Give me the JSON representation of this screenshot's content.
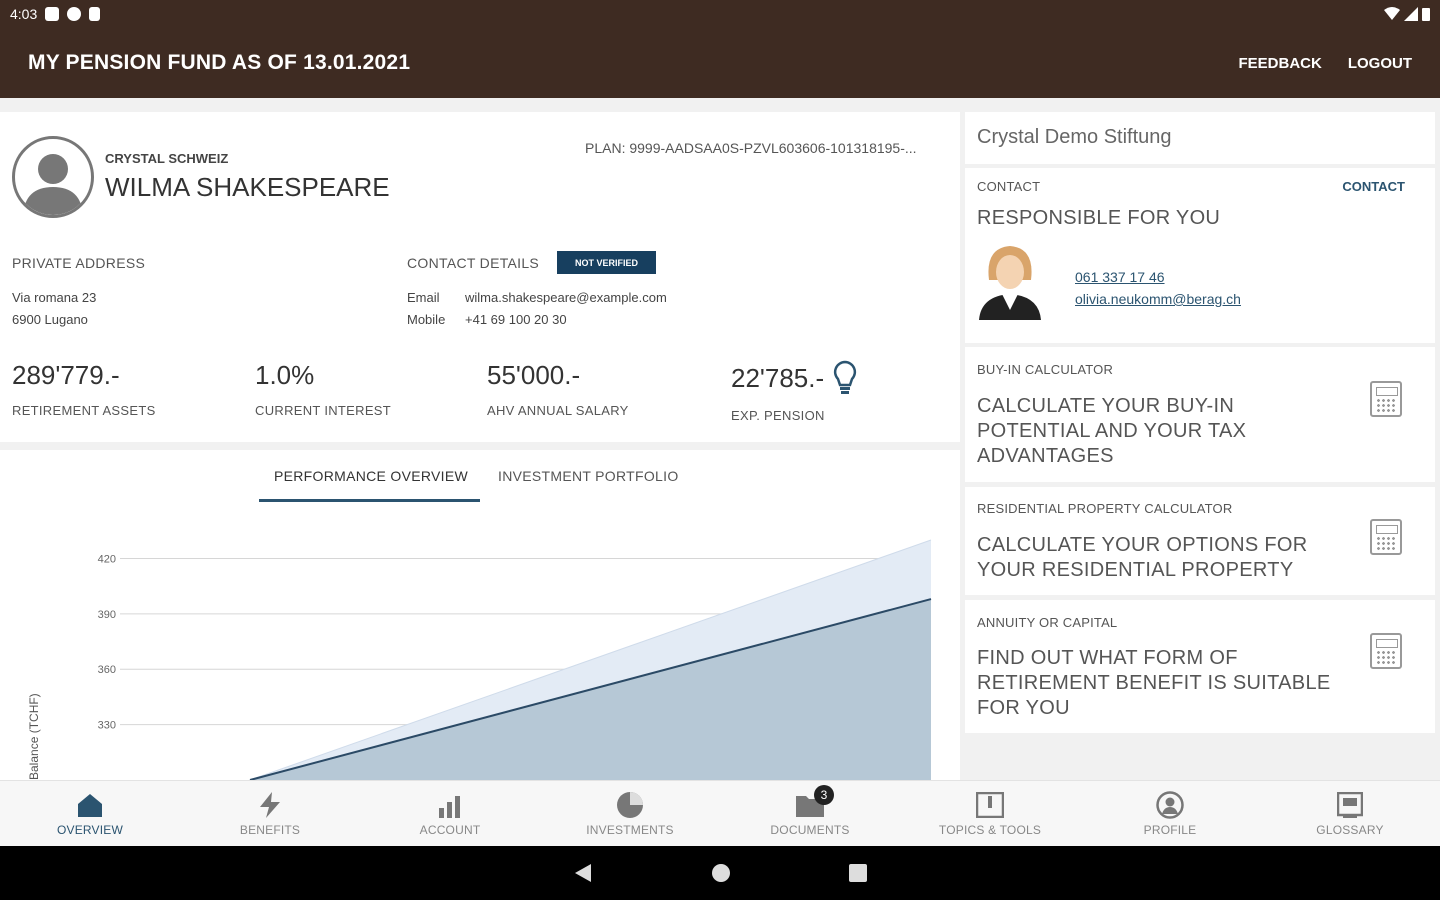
{
  "status_bar": {
    "time": "4:03"
  },
  "appbar": {
    "title": "MY PENSION FUND AS OF 13.01.2021",
    "feedback": "FEEDBACK",
    "logout": "LOGOUT"
  },
  "profile": {
    "company": "CRYSTAL SCHWEIZ",
    "name": "WILMA SHAKESPEARE",
    "plan": "PLAN: 9999-AADSAA0S-PZVL603606-101318195-..."
  },
  "address": {
    "label": "PRIVATE ADDRESS",
    "line1": "Via romana 23",
    "line2": "6900 Lugano"
  },
  "contact_details": {
    "label": "CONTACT DETAILS",
    "badge": "NOT VERIFIED",
    "email_key": "Email",
    "email_value": "wilma.shakespeare@example.com",
    "mobile_key": "Mobile",
    "mobile_value": "+41 69 100 20 30"
  },
  "kpis": [
    {
      "value": "289'779.-",
      "label": "RETIREMENT ASSETS"
    },
    {
      "value": "1.0%",
      "label": "CURRENT INTEREST"
    },
    {
      "value": "55'000.-",
      "label": "AHV ANNUAL SALARY"
    },
    {
      "value": "22'785.-",
      "label": "EXP. PENSION"
    }
  ],
  "tabs": {
    "performance": "PERFORMANCE OVERVIEW",
    "portfolio": "INVESTMENT PORTFOLIO"
  },
  "chart_data": {
    "type": "area",
    "ylabel": "Balance (TCHF)",
    "ytick_labels": [
      "420",
      "390",
      "360",
      "330"
    ],
    "ylim": [
      300,
      430
    ],
    "grid": true,
    "series": [
      {
        "start": 300,
        "end": 430
      },
      {
        "start": 300,
        "end": 398
      }
    ],
    "colors": {
      "upper": "#e3ebf5",
      "lower": "#b6c8d6",
      "line": "#2b4a66"
    }
  },
  "right": {
    "foundation": "Crystal Demo Stiftung",
    "contact_head": "CONTACT",
    "contact_link": "CONTACT",
    "responsible": "RESPONSIBLE FOR YOU",
    "phone": "061 337 17 46",
    "email": "olivia.neukomm@berag.ch",
    "buyin_head": "BUY-IN CALCULATOR",
    "buyin_text": "CALCULATE YOUR BUY-IN POTENTIAL AND YOUR TAX ADVANTAGES",
    "resid_head": "RESIDENTIAL PROPERTY CALCULATOR",
    "resid_text": "CALCULATE YOUR OPTIONS FOR YOUR RESIDENTIAL PROPERTY",
    "annuity_head": "ANNUITY OR CAPITAL",
    "annuity_text": "FIND OUT WHAT FORM OF RETIREMENT BENEFIT IS SUITABLE FOR YOU"
  },
  "nav": [
    {
      "label": "OVERVIEW",
      "icon": "home-icon"
    },
    {
      "label": "BENEFITS",
      "icon": "lightning-icon"
    },
    {
      "label": "ACCOUNT",
      "icon": "bar-chart-icon"
    },
    {
      "label": "INVESTMENTS",
      "icon": "pie-chart-icon"
    },
    {
      "label": "DOCUMENTS",
      "icon": "folder-icon",
      "badge": "3"
    },
    {
      "label": "TOPICS & TOOLS",
      "icon": "book-icon"
    },
    {
      "label": "PROFILE",
      "icon": "user-icon"
    },
    {
      "label": "GLOSSARY",
      "icon": "glossary-icon"
    }
  ],
  "theme": {
    "brand": "#3e2b22",
    "accent": "#2b5470",
    "badge": "#173f5f"
  }
}
